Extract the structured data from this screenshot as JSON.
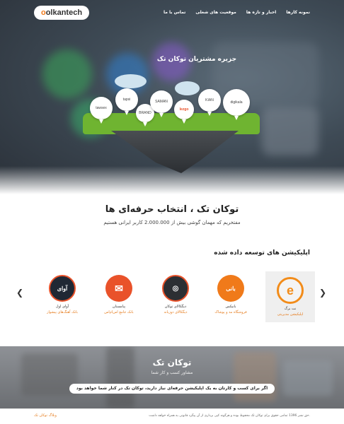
{
  "header": {
    "logo_text_o": "o",
    "logo_text_rest": "olkantech",
    "nav": [
      "نمونه کارها",
      "اخبار و تازه ها",
      "موقعیت های شغلی",
      "تماس با ما"
    ]
  },
  "hero": {
    "title": "جزیره مشتریان توکان تک",
    "logos": [
      "tapsi",
      "BRAND",
      "lezgo",
      "SAMAN",
      "bank",
      "KIAN",
      "tawsex",
      "digikala"
    ]
  },
  "intro": {
    "headline": "توکان تک ، انتخاب حرفه‌ای ها",
    "subline": "مفتخریم که مهمان گوشی بیش از 2.000.000 کاربر ایرانی هستیم"
  },
  "apps": {
    "title": "اپلیکیشن های توسعه داده شده",
    "items": [
      {
        "name": "نت برگ",
        "desc": "اپلیکیشن مدیریتی",
        "color": "#f28c1a",
        "icon_letter": "e"
      },
      {
        "name": "بانیکس",
        "desc": "فروشگاه مد و پوشاک",
        "color": "#f07a1a",
        "icon_letter": "بانی"
      },
      {
        "name": "دیگکالای توکان",
        "desc": "دیگکالای دوزبانه",
        "color": "#2c2f33",
        "icon_letter": "◎"
      },
      {
        "name": "پیامستان",
        "desc": "بانک جامع اس‌ام‌اس",
        "color": "#e9522a",
        "icon_letter": "✉"
      },
      {
        "name": "آوای اول",
        "desc": "بانک آهنگ‌های پیشواز",
        "color": "#202834",
        "icon_letter": "آوای"
      }
    ]
  },
  "banner": {
    "title": "توکان تک",
    "subtitle": "مشاور کسب و کار شما",
    "cta": "اگر برای کسب و کارتان به یک اپلیکیشن حرفه‌ای نیاز دارید، توکان تک در کنار شما خواهد بود"
  },
  "footer": {
    "copyright": "حق نشر 1396 تمامی حقوق برای توکان تک محفوظ بوده و هرگونه کپی برداری از آن پیگرد قانونی به همراه خواهد داشت.",
    "blog": "وبلاگ توکان تک"
  },
  "colors": {
    "accent": "#e57a1a",
    "grass": "#6fb431"
  }
}
